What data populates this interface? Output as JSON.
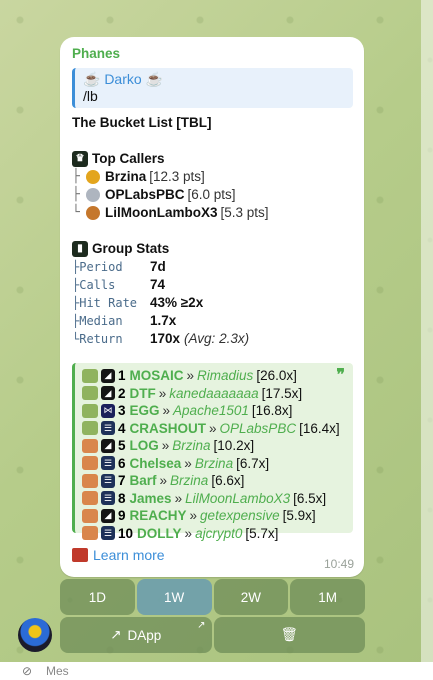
{
  "message": {
    "sender": "Phanes",
    "reply": {
      "name": "☕ Darko ☕",
      "text": "/lb"
    },
    "title": "The Bucket List [TBL]",
    "top_callers": {
      "heading": "Top Callers",
      "items": [
        {
          "tree": "├",
          "name": "Brzina",
          "pts": "[12.3 pts]",
          "medal": "gold"
        },
        {
          "tree": "├",
          "name": "OPLabsPBC",
          "pts": "[6.0 pts]",
          "medal": "silver"
        },
        {
          "tree": "└",
          "name": "LilMoonLamboX3",
          "pts": "[5.3 pts]",
          "medal": "bronze"
        }
      ]
    },
    "group_stats": {
      "heading": "Group Stats",
      "items": [
        {
          "key": "├Period",
          "value": "7d",
          "sub": ""
        },
        {
          "key": "├Calls",
          "value": "74",
          "sub": ""
        },
        {
          "key": "├Hit Rate",
          "value": "43% ≥2x",
          "sub": ""
        },
        {
          "key": "├Median",
          "value": "1.7x",
          "sub": ""
        },
        {
          "key": "└Return",
          "value": "170x",
          "sub": "(Avg: 2.3x)"
        }
      ]
    },
    "calls": [
      {
        "emoji": "money",
        "chain": "sol",
        "rank": "1",
        "token": "MOSAIC",
        "caller": "Rimadius",
        "mult": "[26.0x]"
      },
      {
        "emoji": "money",
        "chain": "sol",
        "rank": "2",
        "token": "DTF",
        "caller": "kanedaaaaaaa",
        "mult": "[17.5x]"
      },
      {
        "emoji": "money",
        "chain": "sui",
        "rank": "3",
        "token": "EGG",
        "caller": "Apache1501",
        "mult": "[16.8x]"
      },
      {
        "emoji": "money",
        "chain": "eth",
        "rank": "4",
        "token": "CRASHOUT",
        "caller": "OPLabsPBC",
        "mult": "[16.4x]"
      },
      {
        "emoji": "party",
        "chain": "sol",
        "rank": "5",
        "token": "LOG",
        "caller": "Brzina",
        "mult": "[10.2x]"
      },
      {
        "emoji": "party",
        "chain": "eth",
        "rank": "6",
        "token": "Chelsea",
        "caller": "Brzina",
        "mult": "[6.7x]"
      },
      {
        "emoji": "party",
        "chain": "eth",
        "rank": "7",
        "token": "Barf",
        "caller": "Brzina",
        "mult": "[6.6x]"
      },
      {
        "emoji": "party",
        "chain": "eth",
        "rank": "8",
        "token": "James",
        "caller": "LilMoonLamboX3",
        "mult": "[6.5x]"
      },
      {
        "emoji": "party",
        "chain": "sol",
        "rank": "9",
        "token": "REACHY",
        "caller": "getexpensive",
        "mult": "[5.9x]"
      },
      {
        "emoji": "party",
        "chain": "eth",
        "rank": "10",
        "token": "DOLLY",
        "caller": "ajcrypt0",
        "mult": "[5.7x]"
      }
    ],
    "separator": "»",
    "quote_mark": "❞",
    "learn_more": "Learn more",
    "time": "10:49"
  },
  "keyboard": {
    "row1": [
      "1D",
      "1W",
      "2W",
      "1M"
    ],
    "selected": "1W",
    "dapp_label": "DApp",
    "dapp_icon": "chart-icon",
    "delete_icon": "trash-icon"
  },
  "input": {
    "placeholder": "Mes"
  },
  "colors": {
    "accent_green": "#4fae4e",
    "link_blue": "#3c8ed8",
    "button_bg": "#6c8a56",
    "button_selected": "#70a0ab"
  }
}
